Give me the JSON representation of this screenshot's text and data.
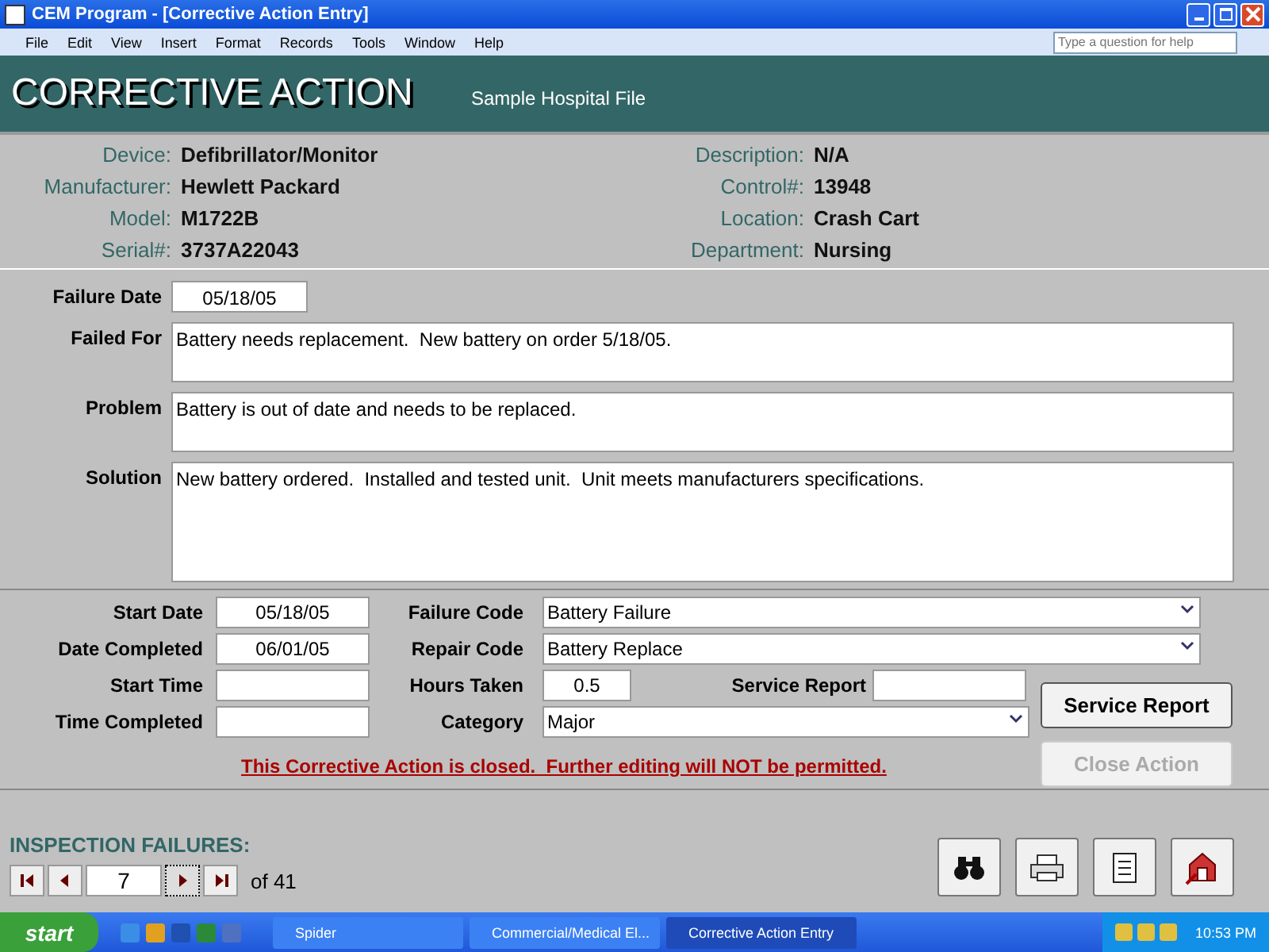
{
  "window": {
    "title": "CEM Program - [Corrective Action Entry]"
  },
  "menu": [
    "File",
    "Edit",
    "View",
    "Insert",
    "Format",
    "Records",
    "Tools",
    "Window",
    "Help"
  ],
  "help_box": {
    "placeholder": "Type a question for help"
  },
  "header": {
    "title": "CORRECTIVE ACTION",
    "subtitle": "Sample Hospital File"
  },
  "device_info": {
    "left": [
      {
        "label": "Device:",
        "value": "Defibrillator/Monitor"
      },
      {
        "label": "Manufacturer:",
        "value": "Hewlett Packard"
      },
      {
        "label": "Model:",
        "value": "M1722B"
      },
      {
        "label": "Serial#:",
        "value": "3737A22043"
      }
    ],
    "right": [
      {
        "label": "Description:",
        "value": "N/A"
      },
      {
        "label": "Control#:",
        "value": "13948"
      },
      {
        "label": "Location:",
        "value": "Crash Cart"
      },
      {
        "label": "Department:",
        "value": "Nursing"
      }
    ]
  },
  "failure_date": {
    "label": "Failure Date",
    "value": "05/18/05"
  },
  "notes": [
    {
      "label": "Failed For",
      "value": "Battery needs replacement.  New battery on order 5/18/05."
    },
    {
      "label": "Problem",
      "value": "Battery is out of date and needs to be replaced."
    },
    {
      "label": "Solution",
      "value": "New battery ordered.  Installed and tested unit.  Unit meets manufacturers specifications."
    }
  ],
  "times": [
    {
      "label": "Start Date",
      "value": "05/18/05"
    },
    {
      "label": "Date Completed",
      "value": "06/01/05"
    },
    {
      "label": "Start Time"
    },
    {
      "label": "Time Completed"
    }
  ],
  "codes": [
    {
      "label": "Failure Code",
      "value": "Battery Failure"
    },
    {
      "label": "Repair Code",
      "value": "Battery Replace"
    }
  ],
  "hours": {
    "label": "Hours Taken",
    "value": "0.5"
  },
  "service_report_field": {
    "label": "Service Report"
  },
  "category": {
    "label": "Category",
    "value": "Major"
  },
  "buttons": [
    {
      "label": "Service Report",
      "disabled": false
    },
    {
      "label": "Close Action",
      "disabled": true
    }
  ],
  "closed_notice": "This Corrective Action is closed.  Further editing will NOT be permitted.",
  "navigation": {
    "title": "INSPECTION FAILURES:",
    "record": "7",
    "total": "of 41"
  },
  "taskbar": {
    "start": "start",
    "tasks": [
      {
        "label": "Spider",
        "selected": false
      },
      {
        "label": "Commercial/Medical El...",
        "selected": false
      },
      {
        "label": "Corrective Action Entry",
        "selected": true
      }
    ],
    "clock": "10:53 PM"
  }
}
